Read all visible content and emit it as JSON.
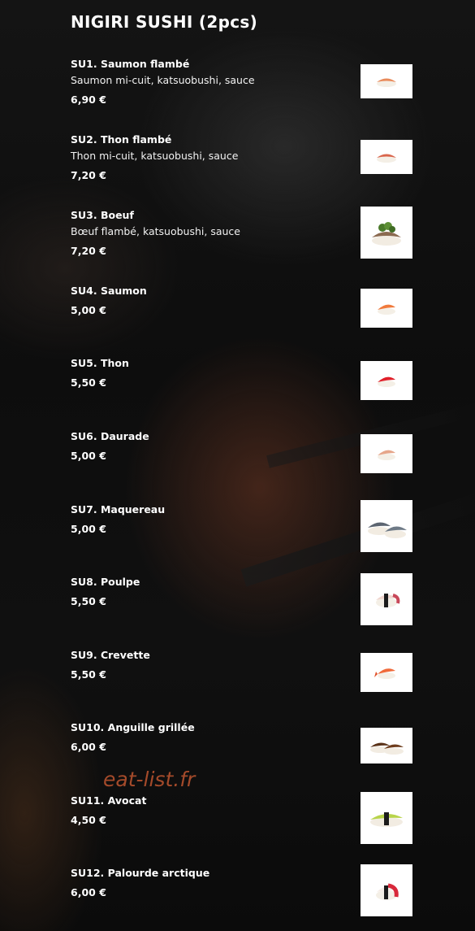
{
  "section": {
    "title": "NIGIRI SUSHI (2pcs)"
  },
  "watermark": "eat-list.fr",
  "items": [
    {
      "name": "SU1. Saumon flambé",
      "desc": "Saumon mi-cuit, katsuobushi, sauce",
      "price": "6,90 €",
      "image_icon": "sushi-seared-salmon-icon"
    },
    {
      "name": "SU2. Thon flambé",
      "desc": "Thon mi-cuit, katsuobushi, sauce",
      "price": "7,20 €",
      "image_icon": "sushi-seared-tuna-icon"
    },
    {
      "name": "SU3. Boeuf",
      "desc": "Bœuf flambé, katsuobushi, sauce",
      "price": "7,20 €",
      "image_icon": "sushi-beef-icon"
    },
    {
      "name": "SU4. Saumon",
      "desc": "",
      "price": "5,00 €",
      "image_icon": "sushi-salmon-icon"
    },
    {
      "name": "SU5. Thon",
      "desc": "",
      "price": "5,50 €",
      "image_icon": "sushi-tuna-icon"
    },
    {
      "name": "SU6. Daurade",
      "desc": "",
      "price": "5,00 €",
      "image_icon": "sushi-sea-bream-icon"
    },
    {
      "name": "SU7. Maquereau",
      "desc": "",
      "price": "5,00 €",
      "image_icon": "sushi-mackerel-icon"
    },
    {
      "name": "SU8. Poulpe",
      "desc": "",
      "price": "5,50 €",
      "image_icon": "sushi-octopus-icon"
    },
    {
      "name": "SU9. Crevette",
      "desc": "",
      "price": "5,50 €",
      "image_icon": "sushi-shrimp-icon"
    },
    {
      "name": "SU10. Anguille grillée",
      "desc": "",
      "price": "6,00 €",
      "image_icon": "sushi-grilled-eel-icon"
    },
    {
      "name": "SU11. Avocat",
      "desc": "",
      "price": "4,50 €",
      "image_icon": "sushi-avocado-icon"
    },
    {
      "name": "SU12. Palourde arctique",
      "desc": "",
      "price": "6,00 €",
      "image_icon": "sushi-arctic-clam-icon"
    }
  ]
}
